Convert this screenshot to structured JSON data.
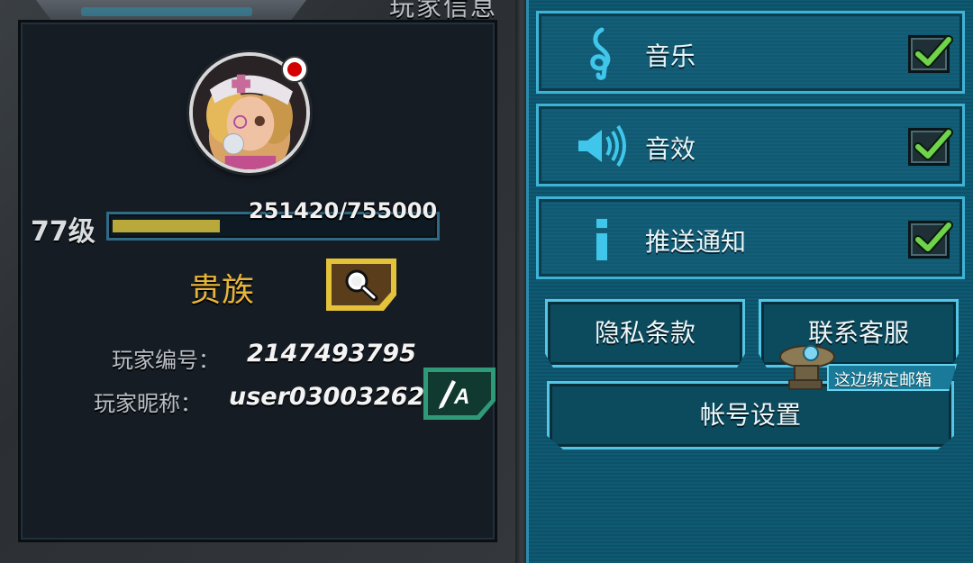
{
  "panel": {
    "title": "玩家信息"
  },
  "player": {
    "level_label": "77级",
    "exp_text": "251420/755000",
    "exp_current": 251420,
    "exp_max": 755000,
    "rank": "贵族",
    "id_label": "玩家编号：",
    "id_value": "2147493795",
    "nickname_label": "玩家昵称：",
    "nickname_value": "user03003262"
  },
  "settings": [
    {
      "label": "音乐",
      "icon": "treble-clef-icon",
      "checked": true
    },
    {
      "label": "音效",
      "icon": "speaker-icon",
      "checked": true
    },
    {
      "label": "推送通知",
      "icon": "info-icon",
      "checked": true
    }
  ],
  "buttons": {
    "privacy": "隐私条款",
    "contact": "联系客服",
    "account": "帐号设置"
  },
  "tooltip": {
    "text": "这边绑定邮箱"
  },
  "colors": {
    "accent_cyan": "#3fb3d6",
    "rank_gold": "#e6b43a",
    "exp_fill": "#b9a93a",
    "check_green": "#6fd34b",
    "notify_red": "#d40000"
  }
}
